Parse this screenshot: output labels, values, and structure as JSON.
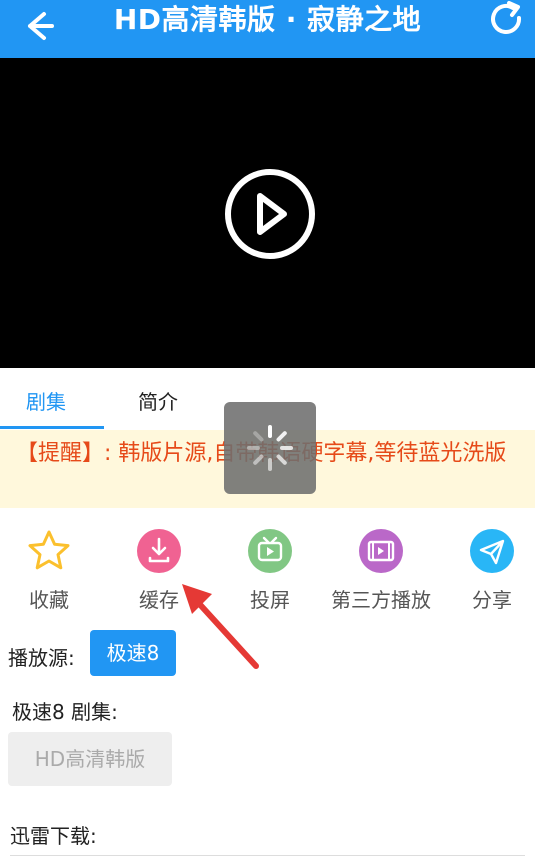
{
  "header": {
    "title": "HD高清韩版 · 寂静之地",
    "back_icon": "back-arrow-icon",
    "refresh_icon": "refresh-icon",
    "color": "#2196F3"
  },
  "tabs": [
    {
      "label": "剧集",
      "active": true
    },
    {
      "label": "简介",
      "active": false
    }
  ],
  "notice": {
    "text": "【提醒】: 韩版片源,自带韩语硬字幕,等待蓝光洗版"
  },
  "actions": [
    {
      "label": "收藏",
      "icon": "star-icon",
      "color": "#FBC02D"
    },
    {
      "label": "缓存",
      "icon": "download-icon",
      "color": "#F06292"
    },
    {
      "label": "投屏",
      "icon": "tv-icon",
      "color": "#81C784"
    },
    {
      "label": "第三方播放",
      "icon": "film-icon",
      "color": "#BA68C8"
    },
    {
      "label": "分享",
      "icon": "paper-plane-icon",
      "color": "#29B6F6"
    }
  ],
  "source": {
    "label": "播放源:",
    "selected": "极速8"
  },
  "episodes": {
    "label": "极速8 剧集:",
    "items": [
      "HD高清韩版"
    ]
  },
  "download": {
    "label": "迅雷下载:"
  }
}
